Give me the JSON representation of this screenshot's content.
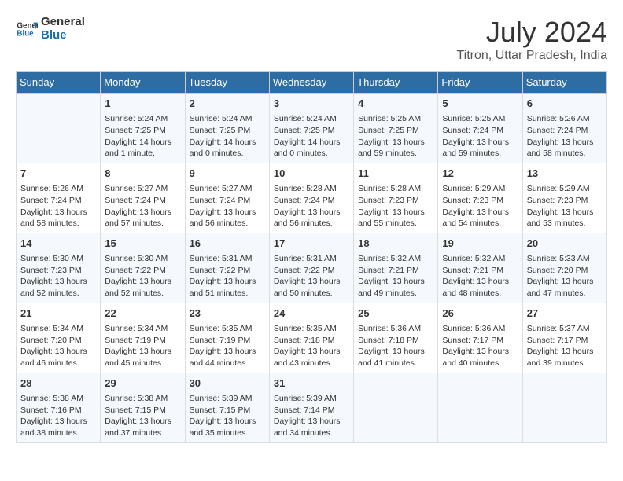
{
  "header": {
    "logo_line1": "General",
    "logo_line2": "Blue",
    "main_title": "July 2024",
    "subtitle": "Titron, Uttar Pradesh, India"
  },
  "columns": [
    "Sunday",
    "Monday",
    "Tuesday",
    "Wednesday",
    "Thursday",
    "Friday",
    "Saturday"
  ],
  "weeks": [
    {
      "cells": [
        {
          "day": "",
          "info": ""
        },
        {
          "day": "1",
          "info": "Sunrise: 5:24 AM\nSunset: 7:25 PM\nDaylight: 14 hours\nand 1 minute."
        },
        {
          "day": "2",
          "info": "Sunrise: 5:24 AM\nSunset: 7:25 PM\nDaylight: 14 hours\nand 0 minutes."
        },
        {
          "day": "3",
          "info": "Sunrise: 5:24 AM\nSunset: 7:25 PM\nDaylight: 14 hours\nand 0 minutes."
        },
        {
          "day": "4",
          "info": "Sunrise: 5:25 AM\nSunset: 7:25 PM\nDaylight: 13 hours\nand 59 minutes."
        },
        {
          "day": "5",
          "info": "Sunrise: 5:25 AM\nSunset: 7:24 PM\nDaylight: 13 hours\nand 59 minutes."
        },
        {
          "day": "6",
          "info": "Sunrise: 5:26 AM\nSunset: 7:24 PM\nDaylight: 13 hours\nand 58 minutes."
        }
      ]
    },
    {
      "cells": [
        {
          "day": "7",
          "info": "Sunrise: 5:26 AM\nSunset: 7:24 PM\nDaylight: 13 hours\nand 58 minutes."
        },
        {
          "day": "8",
          "info": "Sunrise: 5:27 AM\nSunset: 7:24 PM\nDaylight: 13 hours\nand 57 minutes."
        },
        {
          "day": "9",
          "info": "Sunrise: 5:27 AM\nSunset: 7:24 PM\nDaylight: 13 hours\nand 56 minutes."
        },
        {
          "day": "10",
          "info": "Sunrise: 5:28 AM\nSunset: 7:24 PM\nDaylight: 13 hours\nand 56 minutes."
        },
        {
          "day": "11",
          "info": "Sunrise: 5:28 AM\nSunset: 7:23 PM\nDaylight: 13 hours\nand 55 minutes."
        },
        {
          "day": "12",
          "info": "Sunrise: 5:29 AM\nSunset: 7:23 PM\nDaylight: 13 hours\nand 54 minutes."
        },
        {
          "day": "13",
          "info": "Sunrise: 5:29 AM\nSunset: 7:23 PM\nDaylight: 13 hours\nand 53 minutes."
        }
      ]
    },
    {
      "cells": [
        {
          "day": "14",
          "info": "Sunrise: 5:30 AM\nSunset: 7:23 PM\nDaylight: 13 hours\nand 52 minutes."
        },
        {
          "day": "15",
          "info": "Sunrise: 5:30 AM\nSunset: 7:22 PM\nDaylight: 13 hours\nand 52 minutes."
        },
        {
          "day": "16",
          "info": "Sunrise: 5:31 AM\nSunset: 7:22 PM\nDaylight: 13 hours\nand 51 minutes."
        },
        {
          "day": "17",
          "info": "Sunrise: 5:31 AM\nSunset: 7:22 PM\nDaylight: 13 hours\nand 50 minutes."
        },
        {
          "day": "18",
          "info": "Sunrise: 5:32 AM\nSunset: 7:21 PM\nDaylight: 13 hours\nand 49 minutes."
        },
        {
          "day": "19",
          "info": "Sunrise: 5:32 AM\nSunset: 7:21 PM\nDaylight: 13 hours\nand 48 minutes."
        },
        {
          "day": "20",
          "info": "Sunrise: 5:33 AM\nSunset: 7:20 PM\nDaylight: 13 hours\nand 47 minutes."
        }
      ]
    },
    {
      "cells": [
        {
          "day": "21",
          "info": "Sunrise: 5:34 AM\nSunset: 7:20 PM\nDaylight: 13 hours\nand 46 minutes."
        },
        {
          "day": "22",
          "info": "Sunrise: 5:34 AM\nSunset: 7:19 PM\nDaylight: 13 hours\nand 45 minutes."
        },
        {
          "day": "23",
          "info": "Sunrise: 5:35 AM\nSunset: 7:19 PM\nDaylight: 13 hours\nand 44 minutes."
        },
        {
          "day": "24",
          "info": "Sunrise: 5:35 AM\nSunset: 7:18 PM\nDaylight: 13 hours\nand 43 minutes."
        },
        {
          "day": "25",
          "info": "Sunrise: 5:36 AM\nSunset: 7:18 PM\nDaylight: 13 hours\nand 41 minutes."
        },
        {
          "day": "26",
          "info": "Sunrise: 5:36 AM\nSunset: 7:17 PM\nDaylight: 13 hours\nand 40 minutes."
        },
        {
          "day": "27",
          "info": "Sunrise: 5:37 AM\nSunset: 7:17 PM\nDaylight: 13 hours\nand 39 minutes."
        }
      ]
    },
    {
      "cells": [
        {
          "day": "28",
          "info": "Sunrise: 5:38 AM\nSunset: 7:16 PM\nDaylight: 13 hours\nand 38 minutes."
        },
        {
          "day": "29",
          "info": "Sunrise: 5:38 AM\nSunset: 7:15 PM\nDaylight: 13 hours\nand 37 minutes."
        },
        {
          "day": "30",
          "info": "Sunrise: 5:39 AM\nSunset: 7:15 PM\nDaylight: 13 hours\nand 35 minutes."
        },
        {
          "day": "31",
          "info": "Sunrise: 5:39 AM\nSunset: 7:14 PM\nDaylight: 13 hours\nand 34 minutes."
        },
        {
          "day": "",
          "info": ""
        },
        {
          "day": "",
          "info": ""
        },
        {
          "day": "",
          "info": ""
        }
      ]
    }
  ]
}
